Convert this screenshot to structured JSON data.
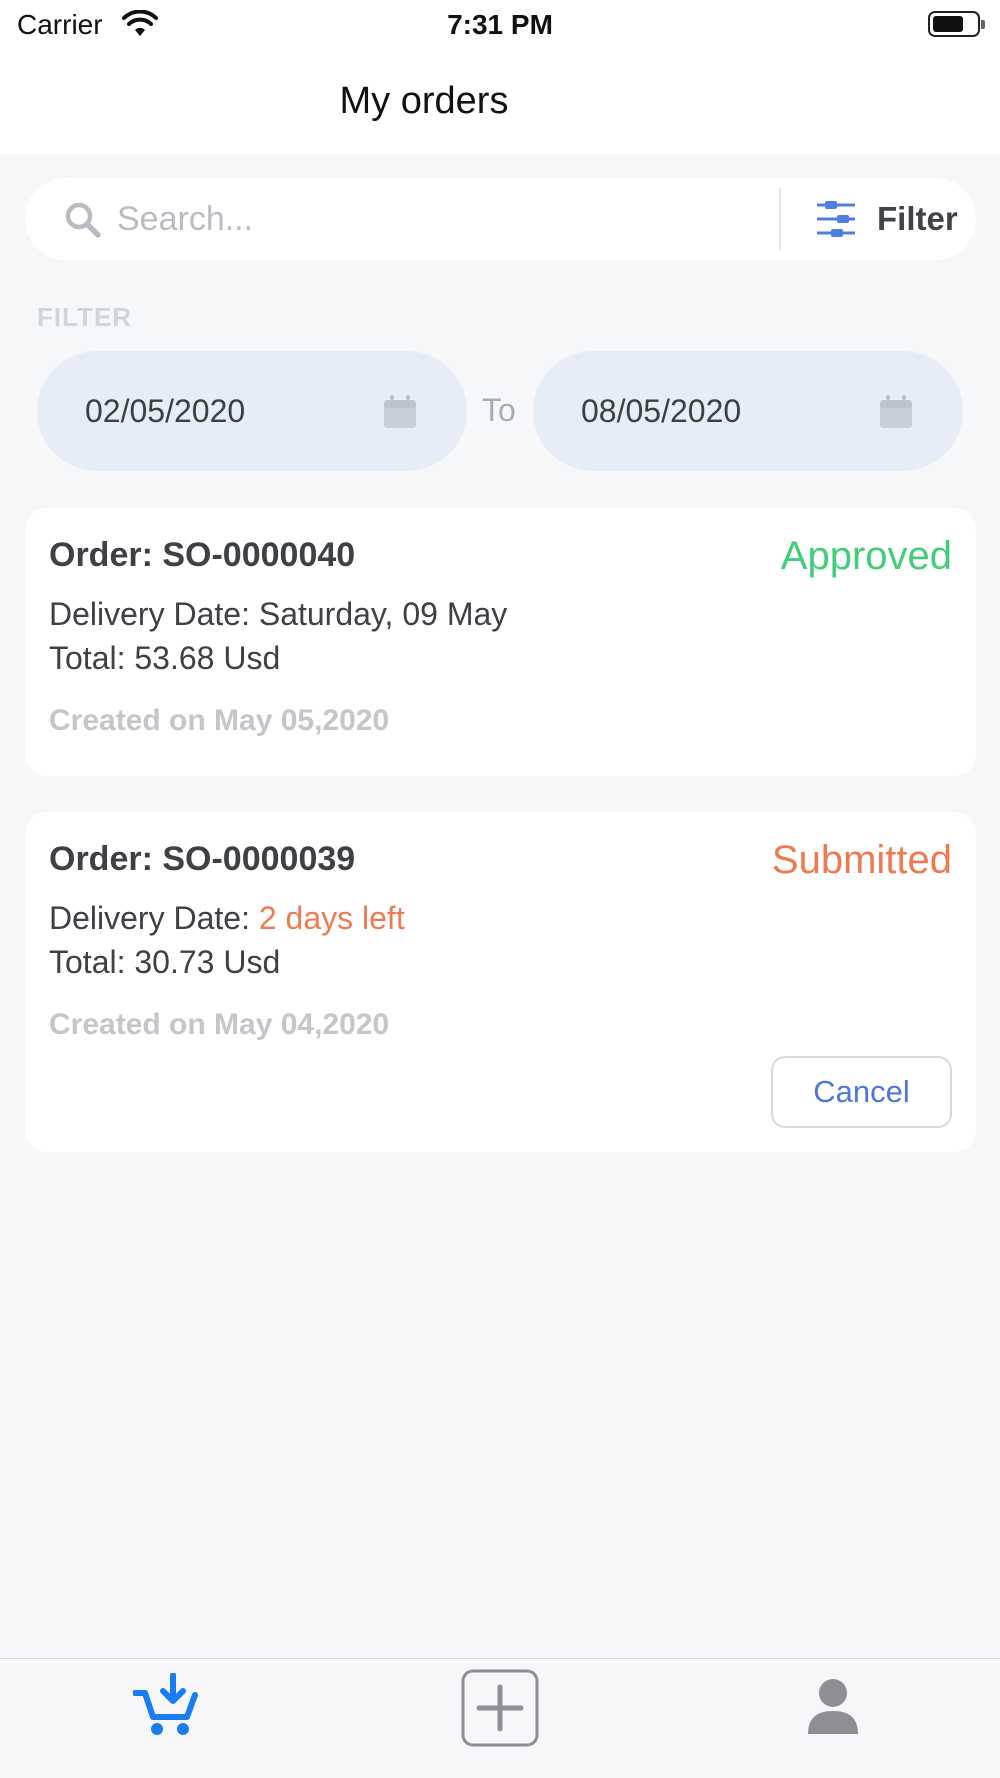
{
  "status_bar": {
    "carrier": "Carrier",
    "time": "7:31 PM"
  },
  "header": {
    "title": "My orders"
  },
  "search": {
    "placeholder": "Search...",
    "filter_label": "Filter"
  },
  "date_filter": {
    "section_label": "FILTER",
    "from_date": "02/05/2020",
    "to_label": "To",
    "to_date": "08/05/2020"
  },
  "orders": [
    {
      "order_label": "Order: SO-0000040",
      "status": "Approved",
      "status_color": "#43cc7a",
      "delivery_prefix": "Delivery Date: ",
      "delivery_value": "Saturday, 09 May",
      "total": "Total: 53.68 Usd",
      "created": "Created on May 05,2020"
    },
    {
      "order_label": "Order: SO-0000039",
      "status": "Submitted",
      "status_color": "#ef7a52",
      "delivery_prefix": "Delivery Date: ",
      "delivery_value": "2 days left",
      "total": "Total: 30.73 Usd",
      "created": "Created on May 04,2020",
      "action_label": "Cancel"
    }
  ],
  "tab_bar": {
    "tabs": [
      {
        "icon": "cart-download-icon",
        "active": true
      },
      {
        "icon": "add-square-icon",
        "active": false
      },
      {
        "icon": "person-icon",
        "active": false
      }
    ],
    "active_color": "#1a7cf2",
    "inactive_color": "#8e8e93"
  },
  "colors": {
    "accent_blue": "#4d77dc",
    "approved": "#43cc7a",
    "submitted": "#ef7a52",
    "background": "#f6f7f9"
  }
}
